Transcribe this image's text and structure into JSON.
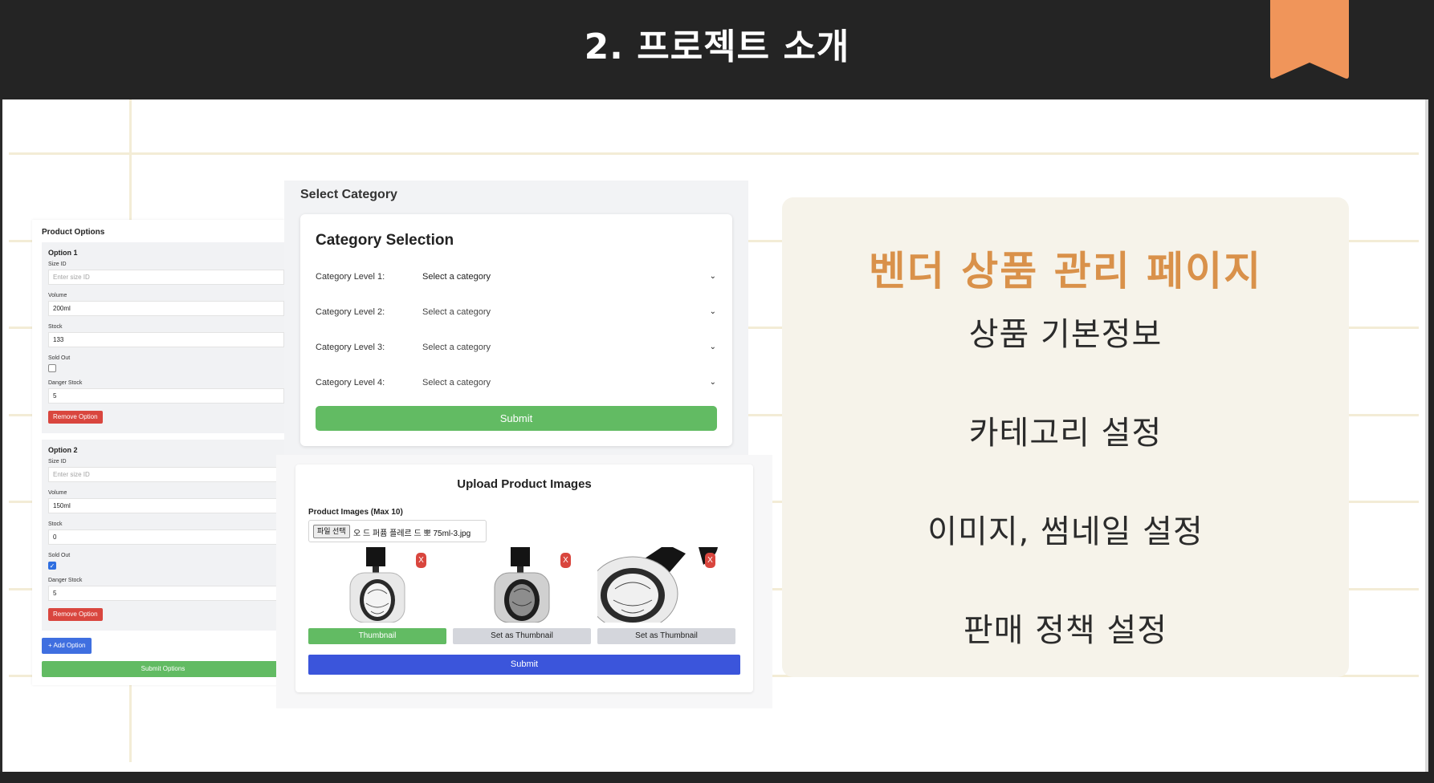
{
  "slide": {
    "title": "2. 프로젝트 소개",
    "colors": {
      "background": "#242424",
      "accent": "#f0955a",
      "highlight_text": "#d9914a",
      "card": "#f6f3ea"
    }
  },
  "product_options": {
    "title": "Product Options",
    "options": [
      {
        "heading": "Option 1",
        "size_id_label": "Size ID",
        "size_id_placeholder": "Enter size ID",
        "volume_label": "Volume",
        "volume_value": "200ml",
        "stock_label": "Stock",
        "stock_value": "133",
        "sold_out_label": "Sold Out",
        "sold_out_checked": false,
        "danger_stock_label": "Danger Stock",
        "danger_stock_value": "5",
        "remove_label": "Remove Option"
      },
      {
        "heading": "Option 2",
        "size_id_label": "Size ID",
        "size_id_placeholder": "Enter size ID",
        "volume_label": "Volume",
        "volume_value": "150ml",
        "stock_label": "Stock",
        "stock_value": "0",
        "sold_out_label": "Sold Out",
        "sold_out_checked": true,
        "danger_stock_label": "Danger Stock",
        "danger_stock_value": "5",
        "remove_label": "Remove Option"
      }
    ],
    "add_label": "+ Add Option",
    "submit_label": "Submit Options"
  },
  "category": {
    "heading": "Select Category",
    "card_title": "Category Selection",
    "rows": [
      {
        "label": "Category Level 1:",
        "value": "Select a category"
      },
      {
        "label": "Category Level 2:",
        "value": "Select a category"
      },
      {
        "label": "Category Level 3:",
        "value": "Select a category"
      },
      {
        "label": "Category Level 4:",
        "value": "Select a category"
      }
    ],
    "submit_label": "Submit"
  },
  "upload": {
    "title": "Upload Product Images",
    "images_label": "Product Images (Max 10)",
    "file_button": "파일 선택",
    "file_name": "오 드 퍼퓸 플레르 드 뽀 75ml-3.jpg",
    "remove_mark": "X",
    "thumbnails": [
      {
        "button_label": "Thumbnail",
        "is_thumbnail": true,
        "image": "perfume-bottle-icon"
      },
      {
        "button_label": "Set as Thumbnail",
        "is_thumbnail": false,
        "image": "perfume-bottle-icon"
      },
      {
        "button_label": "Set as Thumbnail",
        "is_thumbnail": false,
        "image": "perfume-bottle-closeup-icon"
      }
    ],
    "submit_label": "Submit"
  },
  "info": {
    "title": "벤더 상품 관리 페이지",
    "items": [
      "상품 기본정보",
      "카테고리 설정",
      "이미지, 썸네일 설정",
      "판매 정책 설정"
    ]
  }
}
